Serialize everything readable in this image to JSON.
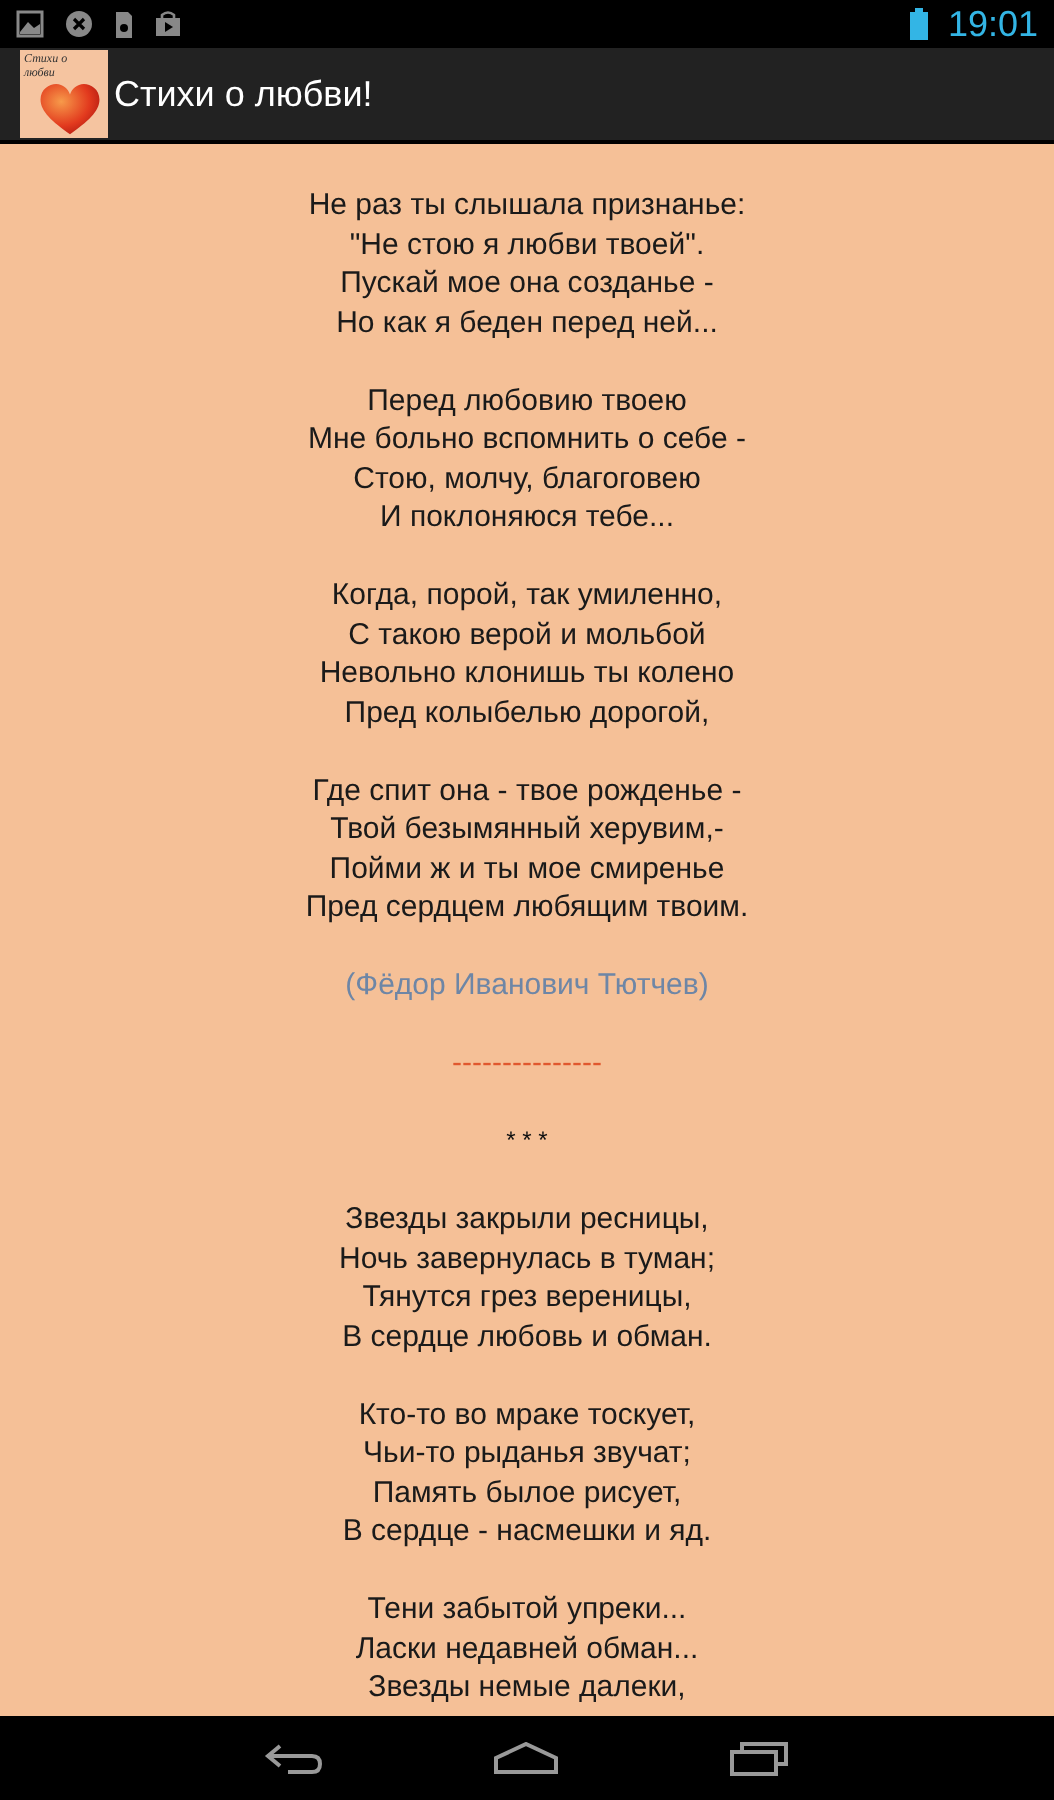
{
  "status_bar": {
    "time": "19:01"
  },
  "app_bar": {
    "title": "Стихи о любви!",
    "icon_caption": "Стихи о любви"
  },
  "content": [
    {
      "kind": "stanza",
      "lines": [
        "Не раз ты слышала признанье:",
        "\"Не стою я любви твоей\".",
        "Пускай мое она созданье -",
        "Но как я беден перед ней..."
      ]
    },
    {
      "kind": "stanza",
      "lines": [
        "Перед любовию твоею",
        "Мне больно вспомнить о себе -",
        "Стою, молчу, благоговею",
        "И поклоняюся тебе..."
      ]
    },
    {
      "kind": "stanza",
      "lines": [
        "Когда, порой, так умиленно,",
        "С такою верой и мольбой",
        "Невольно клонишь ты колено",
        "Пред колыбелью дорогой,"
      ]
    },
    {
      "kind": "stanza",
      "lines": [
        "Где спит она - твое рожденье -",
        "Твой безымянный херувим,-",
        "Пойми ж и ты мое смиренье",
        "Пред сердцем любящим твоим."
      ]
    },
    {
      "kind": "author",
      "text": "(Фёдор Иванович Тютчев)"
    },
    {
      "kind": "separator",
      "text": "---------------"
    },
    {
      "kind": "stars",
      "text": "* * *"
    },
    {
      "kind": "stanza",
      "lines": [
        "Звезды закрыли ресницы,",
        "Ночь завернулась в туман;",
        "Тянутся грез вереницы,",
        "В сердце любовь и обман."
      ]
    },
    {
      "kind": "stanza",
      "lines": [
        "Кто-то во мраке тоскует,",
        "Чьи-то рыданья звучат;",
        "Память былое рисует,",
        "В сердце - насмешки и яд."
      ]
    },
    {
      "kind": "stanza",
      "lines": [
        "Тени забытой упреки...",
        "Ласки недавней обман...",
        "Звезды немые далеки,"
      ]
    }
  ]
}
